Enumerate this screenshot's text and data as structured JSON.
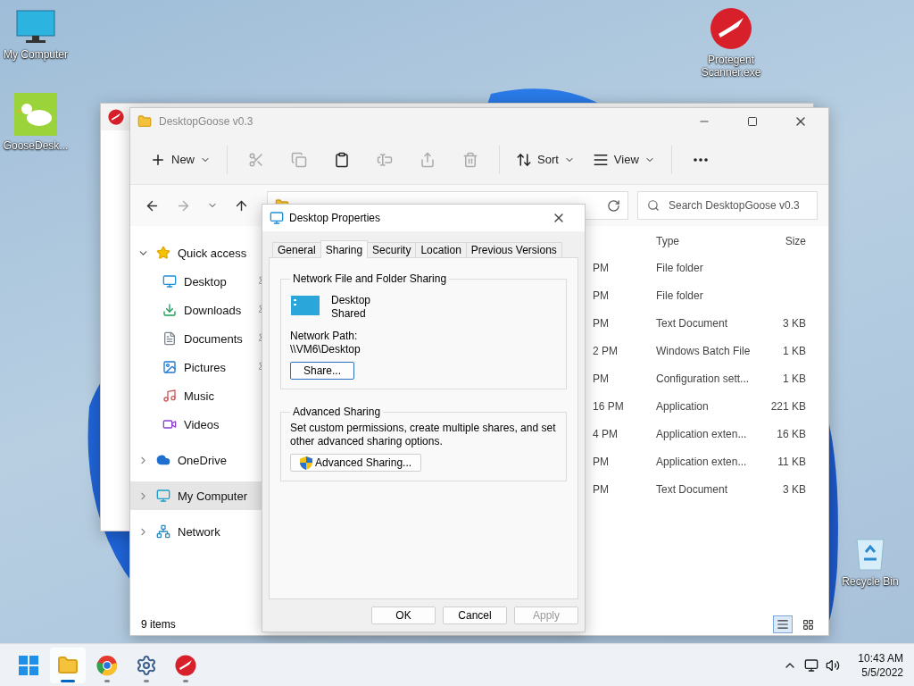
{
  "desktop_icons": [
    {
      "label": "My Computer",
      "kind": "computer"
    },
    {
      "label": "GooseDesk...",
      "kind": "goose"
    },
    {
      "label": "Protegent Scanner.exe",
      "kind": "protegent"
    },
    {
      "label": "Recycle Bin",
      "kind": "recycle"
    }
  ],
  "explorer": {
    "title": "DesktopGoose v0.3",
    "toolbar": [
      {
        "kind": "new",
        "label": "New",
        "disabled": false
      },
      {
        "kind": "cut",
        "disabled": true
      },
      {
        "kind": "copy",
        "disabled": true
      },
      {
        "kind": "paste",
        "disabled": false
      },
      {
        "kind": "rename",
        "disabled": true
      },
      {
        "kind": "share",
        "disabled": true
      },
      {
        "kind": "delete",
        "disabled": true
      },
      {
        "kind": "sort",
        "label": "Sort",
        "disabled": false
      },
      {
        "kind": "view",
        "label": "View",
        "disabled": false
      },
      {
        "kind": "more",
        "disabled": false
      }
    ],
    "search": {
      "placeholder": "Search DesktopGoose v0.3"
    },
    "nav": [
      {
        "label": "Quick access",
        "kind": "star",
        "expanded": true,
        "selected": false,
        "children": [
          {
            "label": "Desktop",
            "kind": "desktop",
            "pinned": true,
            "selected": false
          },
          {
            "label": "Downloads",
            "kind": "downloads",
            "pinned": true,
            "selected": false
          },
          {
            "label": "Documents",
            "kind": "documents",
            "pinned": true,
            "selected": false
          },
          {
            "label": "Pictures",
            "kind": "pictures",
            "pinned": true,
            "selected": false
          },
          {
            "label": "Music",
            "kind": "music",
            "pinned": false,
            "selected": false
          },
          {
            "label": "Videos",
            "kind": "videos",
            "pinned": false,
            "selected": false
          }
        ]
      },
      {
        "label": "OneDrive",
        "kind": "cloud",
        "expanded": false,
        "selected": false
      },
      {
        "label": "My Computer",
        "kind": "computer",
        "expanded": false,
        "selected": true
      },
      {
        "label": "Network",
        "kind": "network",
        "expanded": false,
        "selected": false
      }
    ],
    "columns": [
      "Type",
      "Size"
    ],
    "rows": [
      {
        "date": "PM",
        "type": "File folder",
        "size": ""
      },
      {
        "date": "PM",
        "type": "File folder",
        "size": ""
      },
      {
        "date": "PM",
        "type": "Text Document",
        "size": "3 KB"
      },
      {
        "date": "2 PM",
        "type": "Windows Batch File",
        "size": "1 KB"
      },
      {
        "date": "PM",
        "type": "Configuration sett...",
        "size": "1 KB"
      },
      {
        "date": "16 PM",
        "type": "Application",
        "size": "221 KB"
      },
      {
        "date": "4 PM",
        "type": "Application exten...",
        "size": "16 KB"
      },
      {
        "date": "PM",
        "type": "Application exten...",
        "size": "11 KB"
      },
      {
        "date": "PM",
        "type": "Text Document",
        "size": "3 KB"
      }
    ],
    "status": "9 items",
    "view_modes": [
      {
        "kind": "details",
        "selected": true
      },
      {
        "kind": "tiles",
        "selected": false
      }
    ]
  },
  "dialog": {
    "title": "Desktop Properties",
    "tabs": [
      {
        "label": "General",
        "selected": false
      },
      {
        "label": "Sharing",
        "selected": true
      },
      {
        "label": "Security",
        "selected": false
      },
      {
        "label": "Location",
        "selected": false
      },
      {
        "label": "Previous Versions",
        "selected": false
      }
    ],
    "sharing_group": {
      "title": "Network File and Folder Sharing",
      "folder_name": "Desktop",
      "folder_status": "Shared",
      "path_label": "Network Path:",
      "path": "\\\\VM6\\Desktop",
      "button": "Share..."
    },
    "advanced_group": {
      "title": "Advanced Sharing",
      "description": "Set custom permissions, create multiple shares, and set other advanced sharing options.",
      "button": "Advanced Sharing..."
    },
    "buttons": [
      {
        "label": "OK",
        "disabled": false
      },
      {
        "label": "Cancel",
        "disabled": false
      },
      {
        "label": "Apply",
        "disabled": true
      }
    ]
  },
  "taskbar": {
    "apps": [
      {
        "kind": "start",
        "active": false,
        "running": false
      },
      {
        "kind": "explorer",
        "active": true,
        "running": true
      },
      {
        "kind": "chrome",
        "active": false,
        "running": true
      },
      {
        "kind": "settings",
        "active": false,
        "running": true
      },
      {
        "kind": "protegent",
        "active": false,
        "running": true
      }
    ],
    "time": "10:43 AM",
    "date": "5/5/2022"
  }
}
